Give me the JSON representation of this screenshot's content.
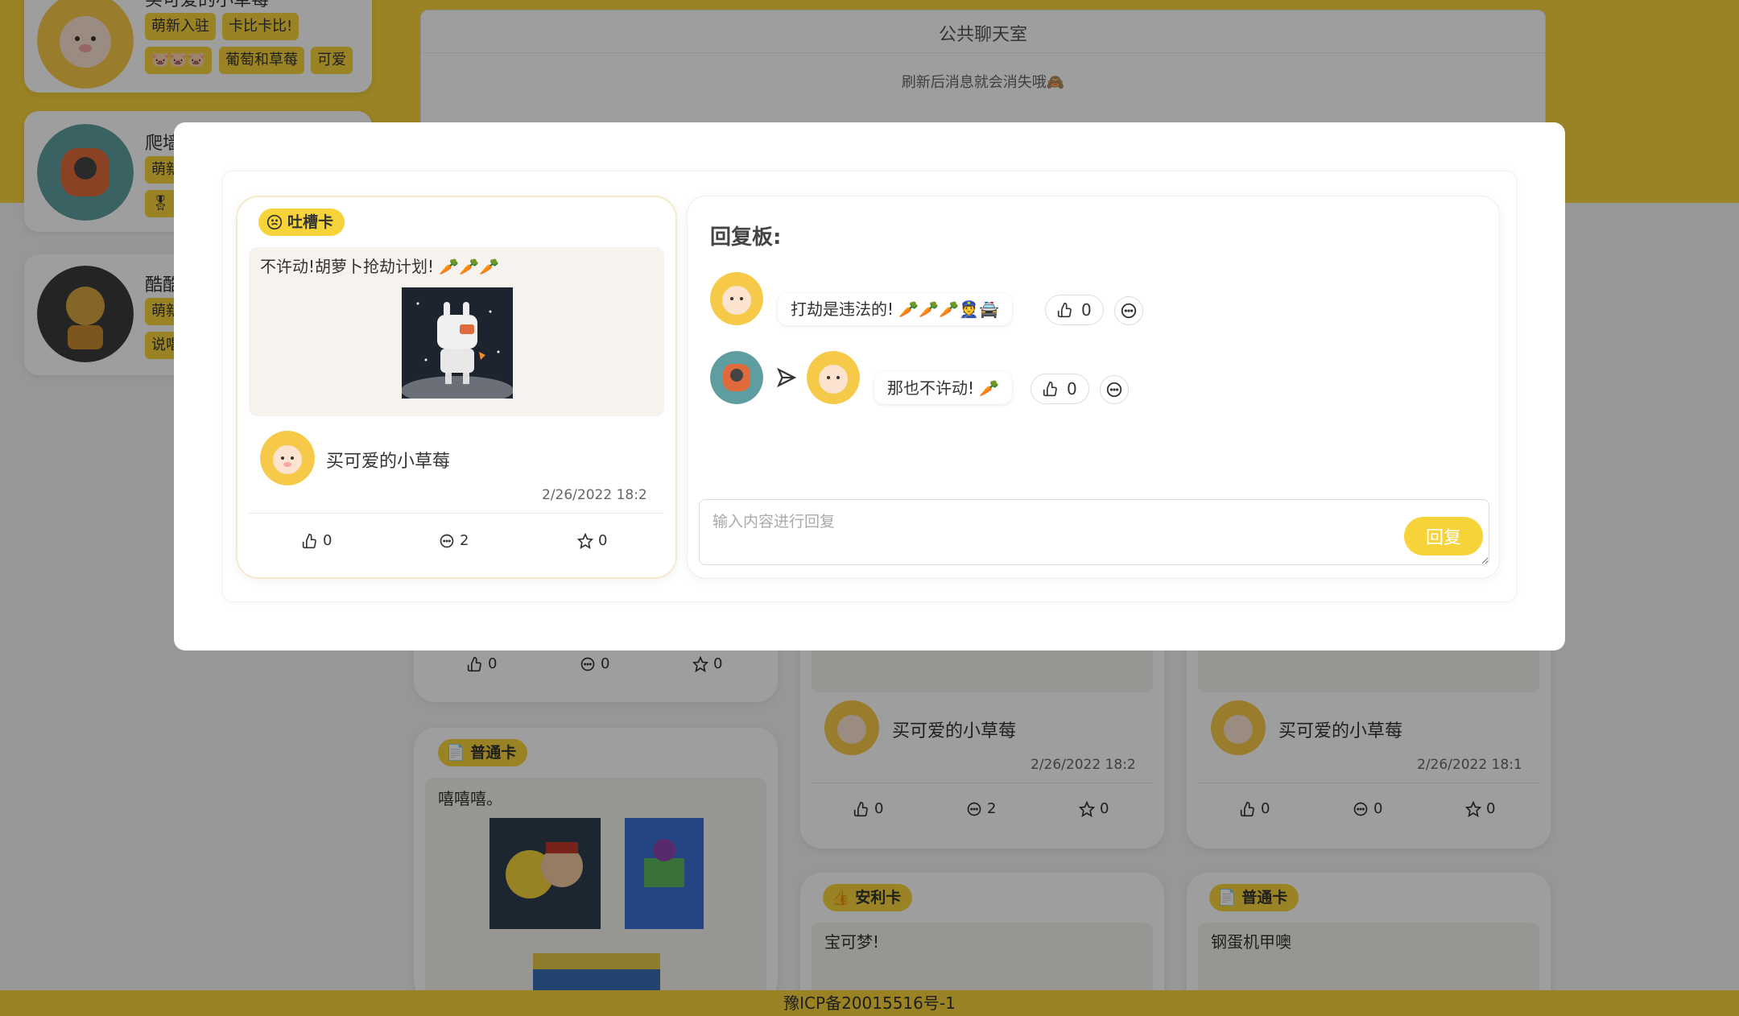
{
  "background": {
    "user_cards": [
      {
        "name": "买可爱的小草莓",
        "tags": [
          "萌新入驻",
          "卡比卡比!",
          "🐷🐷🐷",
          "葡萄和草莓",
          "可爱"
        ]
      },
      {
        "name": "爬墙",
        "tags": [
          "萌新",
          "🎖"
        ]
      },
      {
        "name": "酷酷",
        "tags": [
          "萌新",
          "说唱"
        ]
      }
    ],
    "chat_room": {
      "title": "公共聊天室",
      "subtitle": "刷新后消息就会消失哦🙈"
    },
    "cards": [
      {
        "stats": {
          "likes": "0",
          "comments": "0",
          "stars": "0"
        }
      },
      {
        "badge": "普通卡",
        "text": "嘻嘻嘻。"
      },
      {
        "author": "买可爱的小草莓",
        "time": "2/26/2022 18:2",
        "stats": {
          "likes": "0",
          "comments": "2",
          "stars": "0"
        }
      },
      {
        "author": "买可爱的小草莓",
        "time": "2/26/2022 18:1",
        "stats": {
          "likes": "0",
          "comments": "0",
          "stars": "0"
        }
      },
      {
        "badge": "安利卡",
        "text": "宝可梦!"
      },
      {
        "badge": "普通卡",
        "text": "钢蛋机甲噢"
      }
    ],
    "footer": "豫ICP备20015516号-1"
  },
  "modal": {
    "post": {
      "badge": "吐槽卡",
      "text": "不许动!胡萝卜抢劫计划! 🥕🥕🥕",
      "author": "买可爱的小草莓",
      "time": "2/26/2022 18:2",
      "stats": {
        "likes": "0",
        "comments": "2",
        "stars": "0"
      }
    },
    "reply_board": {
      "title": "回复板:",
      "replies": [
        {
          "text": "打劫是违法的! 🥕🥕🥕👮🚔",
          "likes": "0"
        },
        {
          "text": "那也不许动! 🥕",
          "likes": "0"
        }
      ],
      "input_placeholder": "输入内容进行回复",
      "submit_label": "回复"
    }
  },
  "colors": {
    "accent": "#f7d33a",
    "overlay": "rgba(0,0,0,0.38)"
  }
}
